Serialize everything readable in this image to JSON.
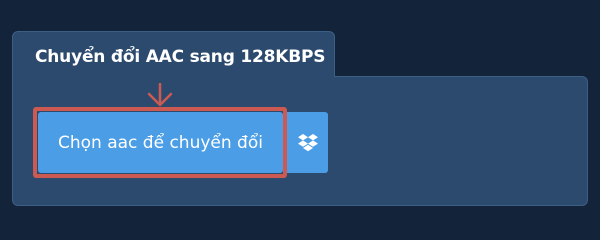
{
  "converter": {
    "tab_title": "Chuyển đổi AAC sang 128KBPS",
    "choose_button_label": "Chọn aac để chuyển đổi",
    "dropbox_icon": "dropbox-icon",
    "arrow_icon": "arrow-down-icon"
  },
  "colors": {
    "page_background": "#12233a",
    "panel_background": "#2c4a6d",
    "button_blue": "#4b9ee6",
    "highlight_red": "#cc5a52"
  }
}
